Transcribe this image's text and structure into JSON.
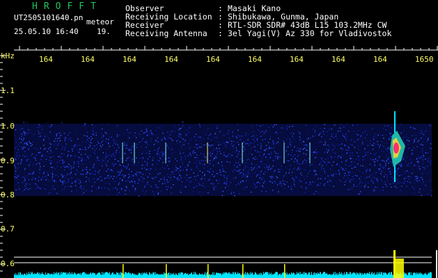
{
  "header": {
    "brand": "HROFFT",
    "filename": "UT2505101640.pn",
    "tag": "meteor",
    "datetime": "25.05.10 16:40",
    "count": "19."
  },
  "meta": [
    {
      "label": "Observer",
      "value": "Masaki Kano"
    },
    {
      "label": "Receiving Location",
      "value": "Shibukawa, Gunma, Japan"
    },
    {
      "label": "Receiver",
      "value": "RTL-SDR SDR# 43dB L15 103.2MHz CW"
    },
    {
      "label": "Receiving Antenna",
      "value": "3el Yagi(V) Az 330 for Vladivostok"
    }
  ],
  "axis": {
    "y_unit": "kHz",
    "x_ticks": [
      "164",
      "164",
      "164",
      "164",
      "164",
      "164",
      "164",
      "164",
      "164",
      "1650"
    ],
    "y_ticks": [
      "1.1",
      "1.0",
      "0.9",
      "0.8",
      "0.7",
      "0.6"
    ]
  },
  "colors": {
    "background": "#000000",
    "text": "#ffffff",
    "axis_labels": "#ffff66",
    "brand": "#22c55e",
    "noise_band": "#1a2fd6",
    "power_bar": "#00e5ff",
    "power_peak": "#ffff00",
    "meteor_core": "#ff3070"
  }
}
